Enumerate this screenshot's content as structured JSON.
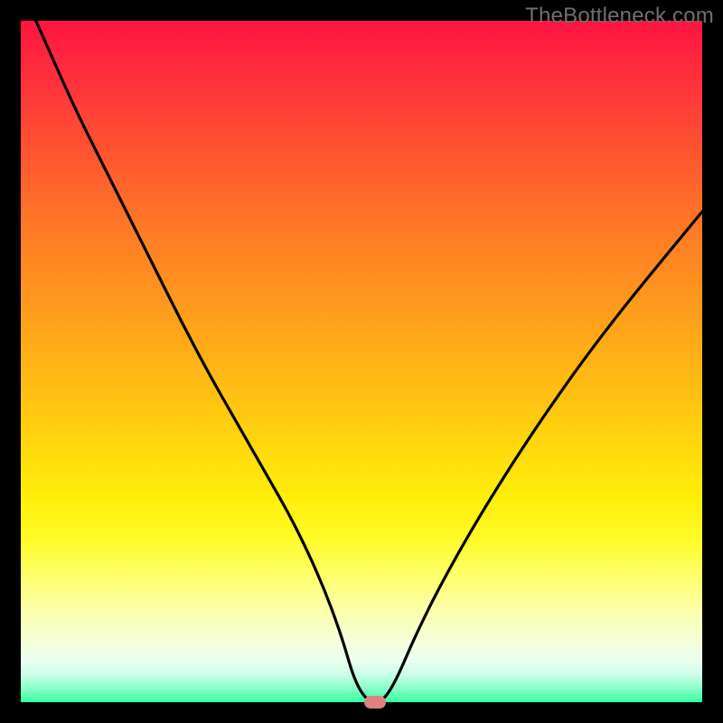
{
  "watermark": "TheBottleneck.com",
  "chart_data": {
    "type": "line",
    "title": "",
    "xlabel": "",
    "ylabel": "",
    "xlim": [
      0,
      100
    ],
    "ylim": [
      0,
      100
    ],
    "grid": false,
    "series": [
      {
        "name": "bottleneck-curve",
        "x": [
          0,
          4,
          8,
          12,
          16,
          20,
          24,
          28,
          32,
          36,
          40,
          44,
          47,
          49,
          51,
          53,
          55,
          58,
          62,
          68,
          76,
          86,
          100
        ],
        "y": [
          105,
          96,
          87,
          79,
          71,
          63,
          55,
          47.5,
          40.5,
          33.5,
          26.5,
          18,
          10,
          3,
          0,
          0,
          3,
          10,
          18,
          28.5,
          41,
          55,
          72
        ]
      }
    ],
    "minimum_marker": {
      "x": 52,
      "y": 0,
      "width_pct": 3.2,
      "height_pct": 1.8
    }
  },
  "colors": {
    "curve": "#000000",
    "marker": "#e08080",
    "frame": "#000000"
  }
}
